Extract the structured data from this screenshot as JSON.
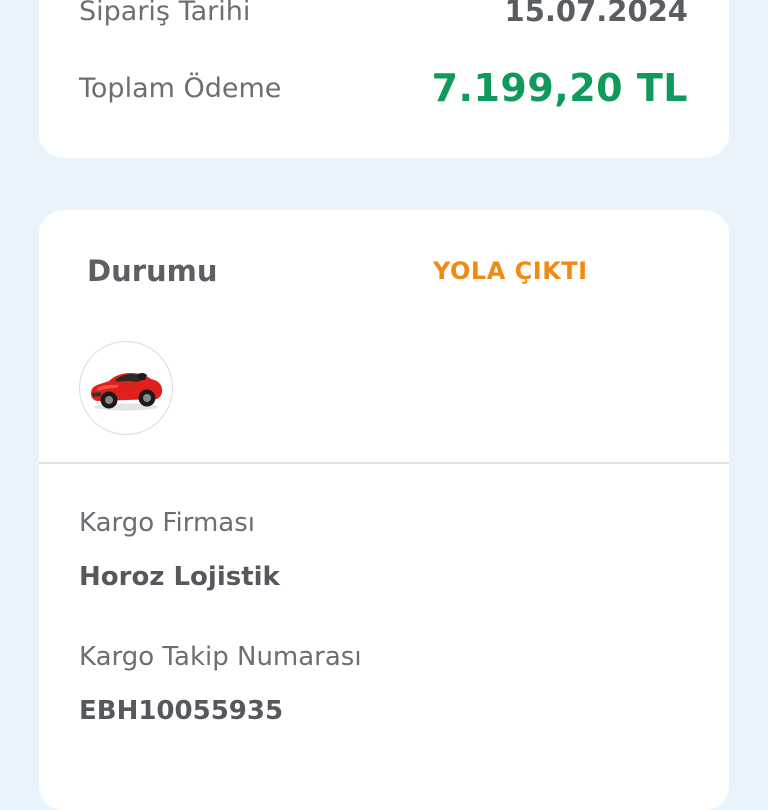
{
  "summary": {
    "order_date_label": "Sipariş Tarihi",
    "order_date_value": "15.07.2024",
    "total_label": "Toplam Ödeme",
    "total_value": "7.199,20 TL"
  },
  "status": {
    "label": "Durumu",
    "value": "YOLA ÇIKTI",
    "product_image_icon": "red-toy-car-image"
  },
  "shipping": {
    "company_label": "Kargo Firması",
    "company_value": "Horoz Lojistik",
    "tracking_label": "Kargo Takip Numarası",
    "tracking_value": "EBH10055935"
  },
  "colors": {
    "background": "#e8f3fb",
    "total_green": "#0f9a5c",
    "status_orange": "#f08a12"
  }
}
